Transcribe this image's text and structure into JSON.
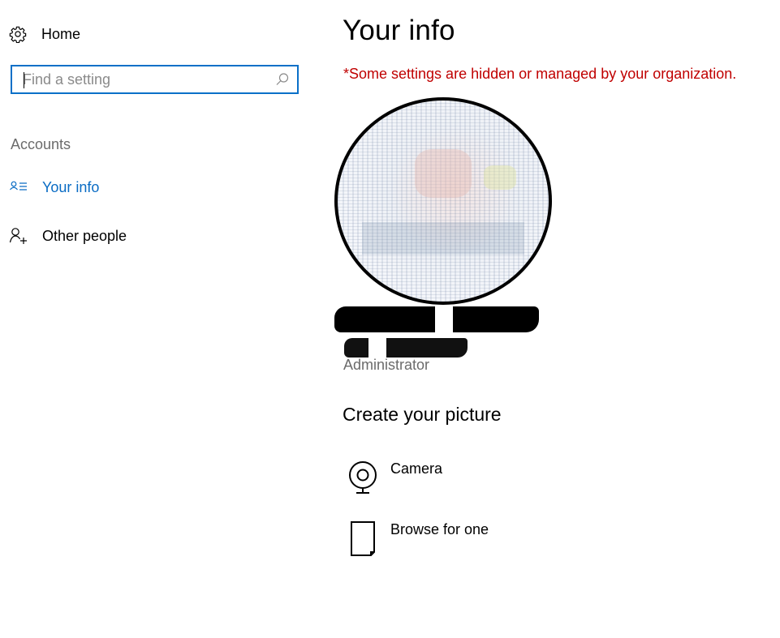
{
  "sidebar": {
    "home_label": "Home",
    "search": {
      "placeholder": "Find a setting",
      "value": ""
    },
    "section_heading": "Accounts",
    "items": [
      {
        "label": "Your info",
        "icon": "contact-info-icon",
        "active": true
      },
      {
        "label": "Other people",
        "icon": "add-person-icon",
        "active": false
      }
    ]
  },
  "main": {
    "title": "Your info",
    "org_notice": "*Some settings are hidden or managed by your organization.",
    "user": {
      "name": "",
      "email": "",
      "role": "Administrator"
    },
    "create_picture": {
      "heading": "Create your picture",
      "options": [
        {
          "label": "Camera",
          "icon": "webcam-icon"
        },
        {
          "label": "Browse for one",
          "icon": "document-icon"
        }
      ]
    }
  },
  "colors": {
    "accent": "#0a6cc4",
    "search_border": "#0a70c8",
    "notice": "#c00000",
    "secondary_text": "#6b6b6b"
  }
}
